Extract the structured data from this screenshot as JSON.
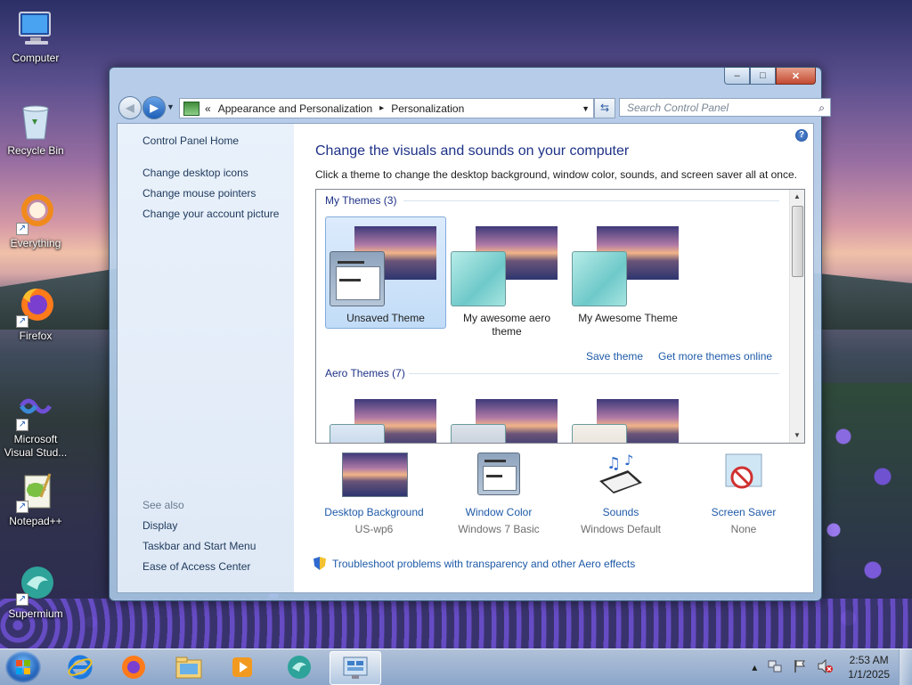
{
  "desktop": {
    "icons": [
      {
        "label": "Computer"
      },
      {
        "label": "Recycle Bin"
      },
      {
        "label": "Everything"
      },
      {
        "label": "Firefox"
      },
      {
        "label": "Microsoft Visual Stud..."
      },
      {
        "label": "Notepad++"
      },
      {
        "label": "Supermium"
      }
    ]
  },
  "window": {
    "caption": {
      "minimize": "–",
      "maximize": "□",
      "close": "✕"
    },
    "address": {
      "chevron": "«",
      "crumbs": [
        "Appearance and Personalization",
        "Personalization"
      ],
      "separator": "▸"
    },
    "refresh": "⇆",
    "search": {
      "placeholder": "Search Control Panel"
    },
    "left_pane": {
      "home": "Control Panel Home",
      "links": [
        "Change desktop icons",
        "Change mouse pointers",
        "Change your account picture"
      ],
      "see_also_label": "See also",
      "see_also": [
        "Display",
        "Taskbar and Start Menu",
        "Ease of Access Center"
      ]
    },
    "main": {
      "title": "Change the visuals and sounds on your computer",
      "subtitle": "Click a theme to change the desktop background, window color, sounds, and screen saver all at once.",
      "my_themes_header": "My Themes (3)",
      "my_themes": [
        {
          "label": "Unsaved Theme",
          "selected": true
        },
        {
          "label": "My awesome aero theme",
          "selected": false
        },
        {
          "label": "My Awesome Theme",
          "selected": false
        }
      ],
      "save_theme": "Save theme",
      "get_more": "Get more themes online",
      "aero_header": "Aero Themes (7)",
      "bottom": [
        {
          "title": "Desktop Background",
          "value": "US-wp6"
        },
        {
          "title": "Window Color",
          "value": "Windows 7 Basic"
        },
        {
          "title": "Sounds",
          "value": "Windows Default"
        },
        {
          "title": "Screen Saver",
          "value": "None"
        }
      ],
      "troubleshoot": "Troubleshoot problems with transparency and other Aero effects"
    }
  },
  "taskbar": {
    "clock_time": "2:53 AM",
    "clock_date": "1/1/2025",
    "tray_expand": "▴"
  },
  "colors": {
    "link": "#1e5aa8",
    "title": "#1e3287",
    "selection": "#c2dcf7"
  }
}
